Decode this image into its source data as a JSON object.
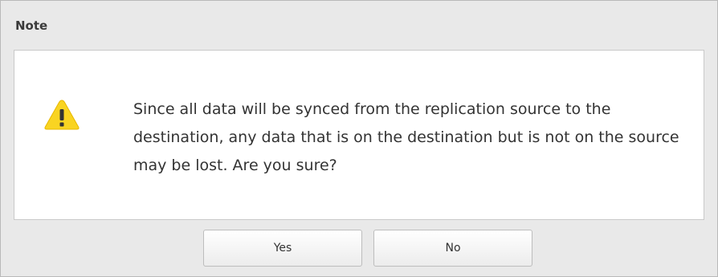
{
  "dialog": {
    "title": "Note",
    "icon": "warning-icon",
    "message": "Since all data will be synced from the replication source to the destination, any data that is on the destination but is not on the source may be lost. Are you sure?",
    "buttons": {
      "yes_label": "Yes",
      "no_label": "No"
    }
  },
  "colors": {
    "warning": "#f9d422",
    "dialog_background": "#e9e9e9",
    "content_background": "#ffffff"
  }
}
